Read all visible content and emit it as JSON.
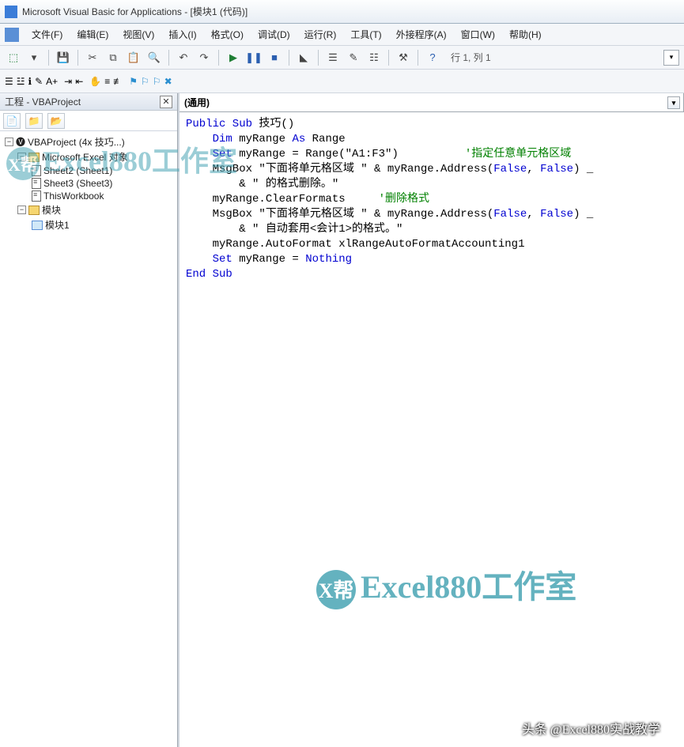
{
  "window": {
    "title": "Microsoft Visual Basic for Applications - [模块1 (代码)]"
  },
  "menu": {
    "items": [
      {
        "label": "文件(F)"
      },
      {
        "label": "编辑(E)"
      },
      {
        "label": "视图(V)"
      },
      {
        "label": "插入(I)"
      },
      {
        "label": "格式(O)"
      },
      {
        "label": "调试(D)"
      },
      {
        "label": "运行(R)"
      },
      {
        "label": "工具(T)"
      },
      {
        "label": "外接程序(A)"
      },
      {
        "label": "窗口(W)"
      },
      {
        "label": "帮助(H)"
      }
    ]
  },
  "toolbar": {
    "status": "行 1, 列 1"
  },
  "project_panel": {
    "title": "工程 - VBAProject",
    "root": "VBAProject (4x 技巧...)",
    "excel_objects": "Microsoft Excel 对象",
    "sheets": [
      {
        "label": "Sheet2 (Sheet1)"
      },
      {
        "label": "Sheet3 (Sheet3)"
      },
      {
        "label": "ThisWorkbook"
      }
    ],
    "modules_label": "模块",
    "module_item": "模块1"
  },
  "code_combo": {
    "left": "(通用)"
  },
  "code": {
    "l1a": "Public Sub",
    "l1b": " 技巧()",
    "l2a": "    Dim",
    "l2b": " myRange ",
    "l2c": "As",
    "l2d": " Range",
    "l3a": "    Set",
    "l3b": " myRange = Range(\"A1:F3\")          ",
    "l3c": "'指定任意单元格区域",
    "l4": "    MsgBox \"下面将单元格区域 \" & myRange.Address(",
    "l4b": "False",
    "l4c": ", ",
    "l4d": "False",
    "l4e": ") _",
    "l5": "        & \" 的格式删除。\"",
    "l6": "    myRange.ClearFormats     ",
    "l6b": "'删除格式",
    "l7": "    MsgBox \"下面将单元格区域 \" & myRange.Address(",
    "l7b": "False",
    "l7c": ", ",
    "l7d": "False",
    "l7e": ") _",
    "l8": "        & \" 自动套用<会计1>的格式。\"",
    "l9": "    myRange.AutoFormat xlRangeAutoFormatAccounting1",
    "l10a": "    Set",
    "l10b": " myRange = ",
    "l10c": "Nothing",
    "l11": "End Sub"
  },
  "watermark": {
    "text": "Excel880工作室",
    "logo": "X帮"
  },
  "caption": "头条 @Excel880实战教学"
}
